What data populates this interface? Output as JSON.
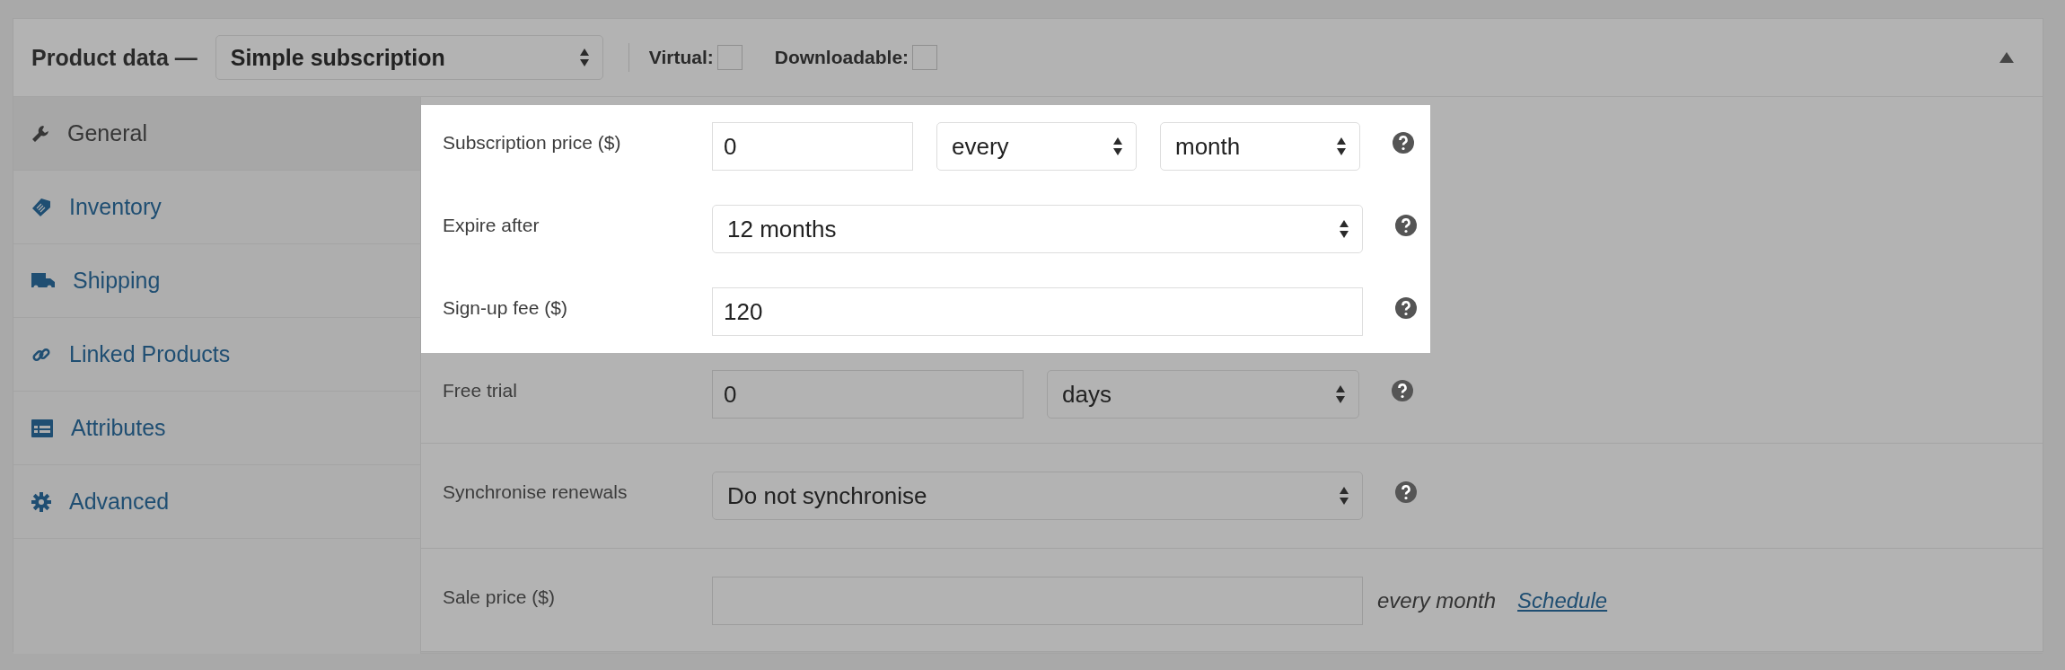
{
  "header": {
    "title": "Product data —",
    "product_type": "Simple subscription",
    "checkboxes": [
      {
        "label": "Virtual:",
        "checked": false
      },
      {
        "label": "Downloadable:",
        "checked": false
      }
    ],
    "expanded": true
  },
  "sidebar": {
    "items": [
      {
        "label": "General",
        "selected": true
      },
      {
        "label": "Inventory",
        "selected": false
      },
      {
        "label": "Shipping",
        "selected": false
      },
      {
        "label": "Linked Products",
        "selected": false
      },
      {
        "label": "Attributes",
        "selected": false
      },
      {
        "label": "Advanced",
        "selected": false
      }
    ]
  },
  "sections": [
    {
      "rows": [
        {
          "label": "Subscription price ($)",
          "highlighted": true,
          "controls": [
            {
              "kind": "input",
              "value": "0"
            },
            {
              "kind": "select",
              "value": "every"
            },
            {
              "kind": "select",
              "value": "month"
            },
            {
              "kind": "help"
            }
          ]
        },
        {
          "label": "Expire after",
          "highlighted": true,
          "controls": [
            {
              "kind": "select",
              "value": "12 months"
            },
            {
              "kind": "help"
            }
          ]
        },
        {
          "label": "Sign-up fee ($)",
          "highlighted": true,
          "controls": [
            {
              "kind": "input",
              "value": "120"
            },
            {
              "kind": "help"
            }
          ]
        },
        {
          "label": "Free trial",
          "highlighted": false,
          "controls": [
            {
              "kind": "input",
              "value": "0"
            },
            {
              "kind": "select",
              "value": "days"
            },
            {
              "kind": "help"
            }
          ]
        }
      ]
    },
    {
      "rows": [
        {
          "label": "Synchronise renewals",
          "highlighted": false,
          "controls": [
            {
              "kind": "select",
              "value": "Do not synchronise"
            },
            {
              "kind": "help"
            }
          ]
        }
      ]
    },
    {
      "rows": [
        {
          "label": "Sale price ($)",
          "highlighted": false,
          "controls": [
            {
              "kind": "input"
            },
            {
              "kind": "text",
              "value": "every month"
            },
            {
              "kind": "link",
              "value": "Schedule"
            }
          ]
        }
      ]
    }
  ]
}
